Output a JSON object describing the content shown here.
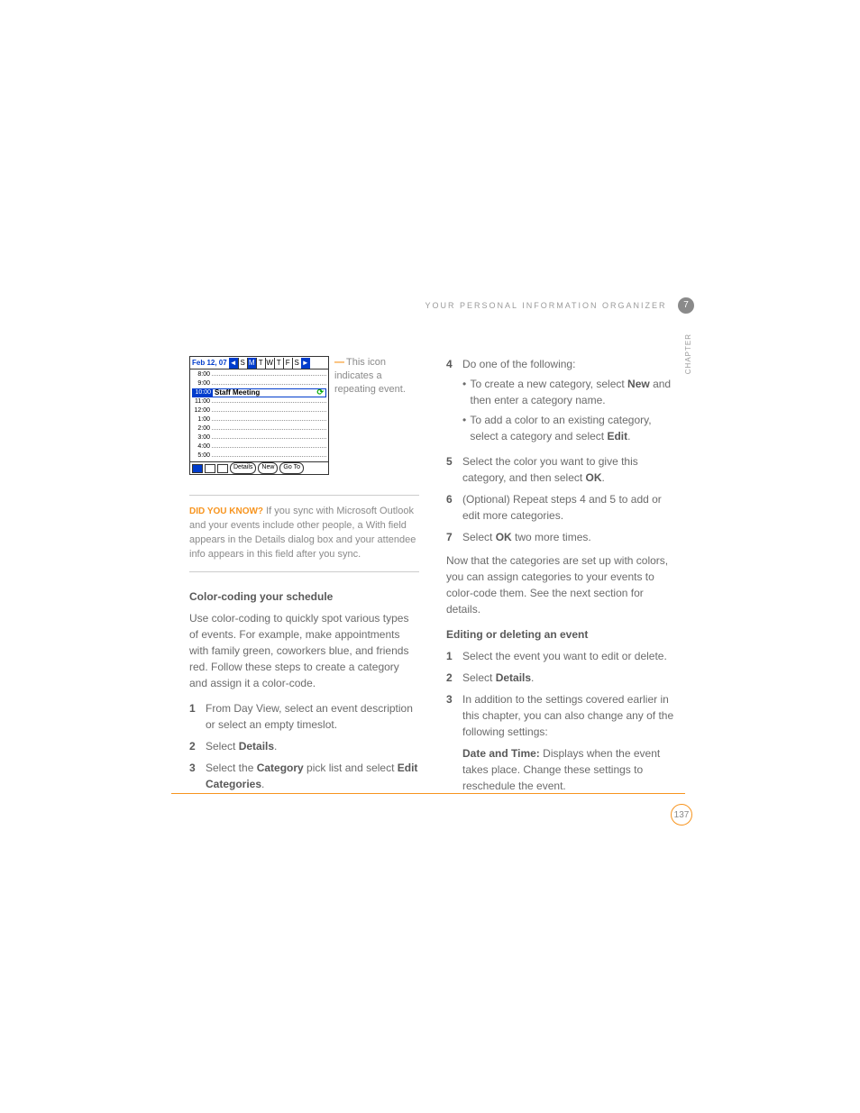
{
  "header": {
    "running_head": "YOUR PERSONAL INFORMATION ORGANIZER",
    "chapter_num": "7",
    "chapter_label": "CHAPTER"
  },
  "screenshot": {
    "date": "Feb 12, 07",
    "days": [
      "S",
      "M",
      "T",
      "W",
      "T",
      "F",
      "S"
    ],
    "selected_day_index": 1,
    "rows": [
      {
        "time": "8:00",
        "event": ""
      },
      {
        "time": "9:00",
        "event": ""
      },
      {
        "time": "10:00",
        "event": "Staff Meeting",
        "highlighted": true,
        "repeat": true
      },
      {
        "time": "11:00",
        "event": ""
      },
      {
        "time": "12:00",
        "event": ""
      },
      {
        "time": "1:00",
        "event": ""
      },
      {
        "time": "2:00",
        "event": ""
      },
      {
        "time": "3:00",
        "event": ""
      },
      {
        "time": "4:00",
        "event": ""
      },
      {
        "time": "5:00",
        "event": ""
      }
    ],
    "buttons": [
      "Details",
      "New",
      "Go To"
    ]
  },
  "callout": "This icon indicates a repeating event.",
  "tip": {
    "label": "DID YOU KNOW?",
    "text": " If you sync with Microsoft Outlook and your events include other people, a With field appears in the Details dialog box and your attendee info appears in this field after you sync."
  },
  "left": {
    "subhead": "Color-coding your schedule",
    "para": "Use color-coding to quickly spot various types of events. For example, make appointments with family green, coworkers blue, and friends red. Follow these steps to create a category and assign it a color-code.",
    "steps": [
      {
        "n": "1",
        "t": "From Day View, select an event description or select an empty timeslot."
      },
      {
        "n": "2",
        "t_pre": "Select ",
        "b": "Details",
        "t_post": "."
      },
      {
        "n": "3",
        "t_pre": "Select the ",
        "b": "Category",
        "t_mid": " pick list and select ",
        "b2": "Edit Categories",
        "t_post": "."
      }
    ]
  },
  "right": {
    "steps4": [
      {
        "n": "4",
        "t": "Do one of the following:",
        "subs": [
          {
            "t_pre": "To create a new category, select ",
            "b": "New",
            "t_post": " and then enter a category name."
          },
          {
            "t_pre": "To add a color to an existing category, select a category and select ",
            "b": "Edit",
            "t_post": "."
          }
        ]
      },
      {
        "n": "5",
        "t_pre": "Select the color you want to give this category, and then select ",
        "b": "OK",
        "t_post": "."
      },
      {
        "n": "6",
        "t": "(Optional) Repeat steps 4 and 5 to add or edit more categories."
      },
      {
        "n": "7",
        "t_pre": "Select ",
        "b": "OK",
        "t_post": " two more times."
      }
    ],
    "p_after": "Now that the categories are set up with colors, you can assign categories to your events to color-code them. See the next section for details.",
    "subhead2": "Editing or deleting an event",
    "steps_b": [
      {
        "n": "1",
        "t": "Select the event you want to edit or delete."
      },
      {
        "n": "2",
        "t_pre": "Select ",
        "b": "Details",
        "t_post": "."
      },
      {
        "n": "3",
        "t": "In addition to the settings covered earlier in this chapter, you can also change any of the following settings:",
        "tail_label": "Date and Time:",
        "tail": " Displays when the event takes place. Change these settings to reschedule the event."
      }
    ]
  },
  "page_number": "137"
}
